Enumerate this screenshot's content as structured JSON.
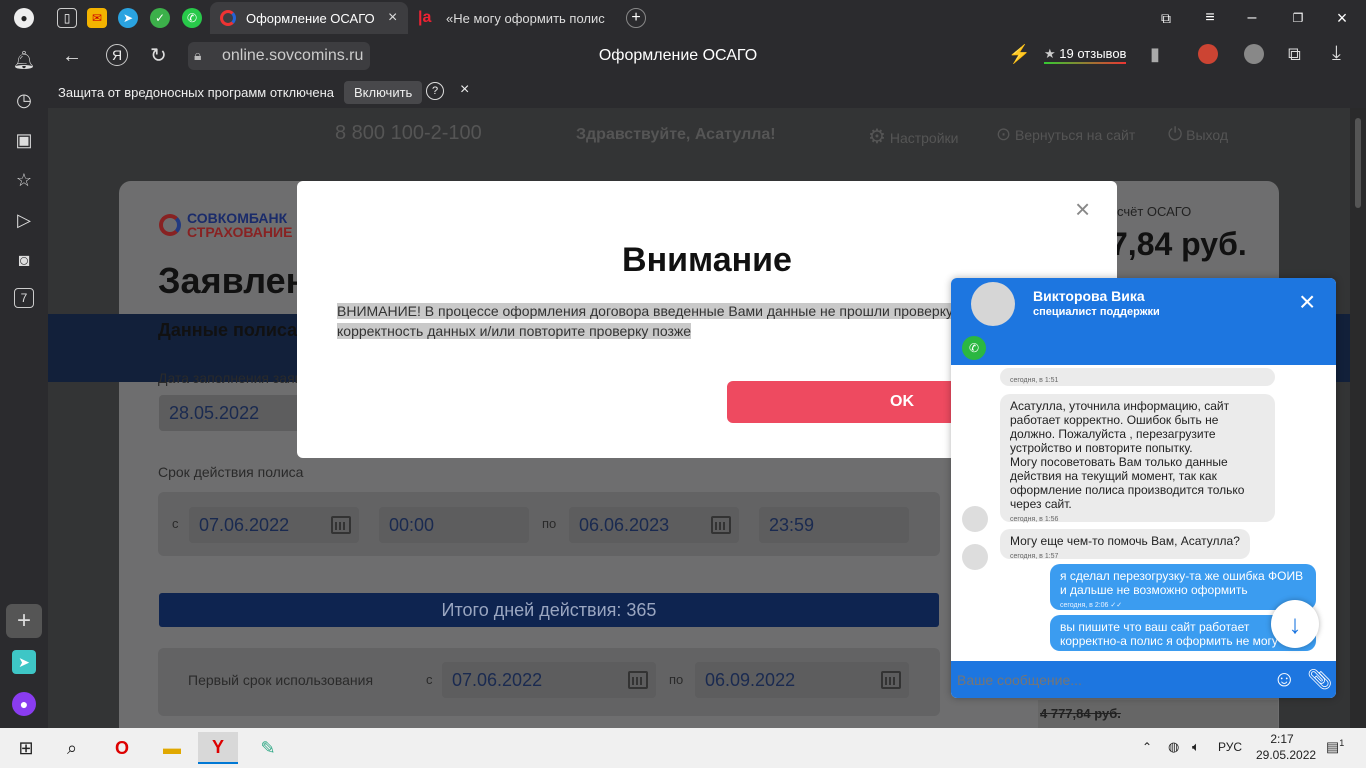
{
  "browser": {
    "tabs": [
      {
        "label": "Оформление ОСАГО",
        "active": true
      },
      {
        "label": "«Не могу оформить полис",
        "active": false
      }
    ],
    "url": "online.sovcomins.ru",
    "page_title": "Оформление ОСАГО",
    "reviews": "19 отзывов",
    "security_notice": "Защита от вредоносных программ отключена",
    "enable_button": "Включить",
    "sidebar_badge": "7"
  },
  "site": {
    "phone": "8 800 100-2-100",
    "greeting": "Здравствуйте, Асатулла!",
    "settings": "Настройки",
    "back_to_site": "Вернуться на сайт",
    "logout": "Выход",
    "logo_line1": "СОВКОМБАНК",
    "logo_line2": "СТРАХОВАНИЕ",
    "heading": "Заявлен",
    "section": "Данные полиса",
    "fill_date_label": "Дата заполнения заяв",
    "fill_date": "28.05.2022",
    "validity_label": "Срок действия полиса",
    "from_label": "с",
    "to_label": "по",
    "start_date": "07.06.2022",
    "start_time": "00:00",
    "end_date": "06.06.2023",
    "end_time": "23:59",
    "total_days": "Итого дней действия: 365",
    "first_period_label": "Первый срок использования",
    "first_from": "07.06.2022",
    "first_to": "06.09.2022",
    "calc_label": "счёт ОСАГО",
    "price": "7,84 руб.",
    "old_price": "4 777,84 руб."
  },
  "modal": {
    "title": "Внимание",
    "message_line1": "ВНИМАНИЕ! В процессе оформления договора введенные Вами данные не прошли проверку",
    "message_line2": "корректность данных и/или повторите проверку позже",
    "ok": "OK"
  },
  "chat": {
    "agent_name": "Викторова Вика",
    "agent_role": "специалист поддержки",
    "messages": [
      {
        "time": "сегодня, в 1:51"
      },
      {
        "text": "Асатулла, уточнила информацию, сайт работает корректно. Ошибок быть не должно. Пожалуйста , перезагрузите устройство и повторите попытку.\nМогу посоветовать Вам только данные действия на текущий момент, так как оформление полиса производится только через сайт.",
        "time": "сегодня, в 1:56"
      },
      {
        "text": "Могу еще чем-то помочь Вам, Асатулла?",
        "time": "сегодня, в 1:57"
      },
      {
        "text": "я сделал перезогрузку-та же ошибка ФОИВ и дальше не возможно оформить",
        "time": "сегодня, в 2:06"
      },
      {
        "text": "вы пишите что ваш сайт работает корректно-а полис я оформить не могу"
      }
    ],
    "input_placeholder": "Ваше сообщение..."
  },
  "taskbar": {
    "lang": "РУС",
    "time": "2:17",
    "date": "29.05.2022",
    "notif_count": "1"
  }
}
